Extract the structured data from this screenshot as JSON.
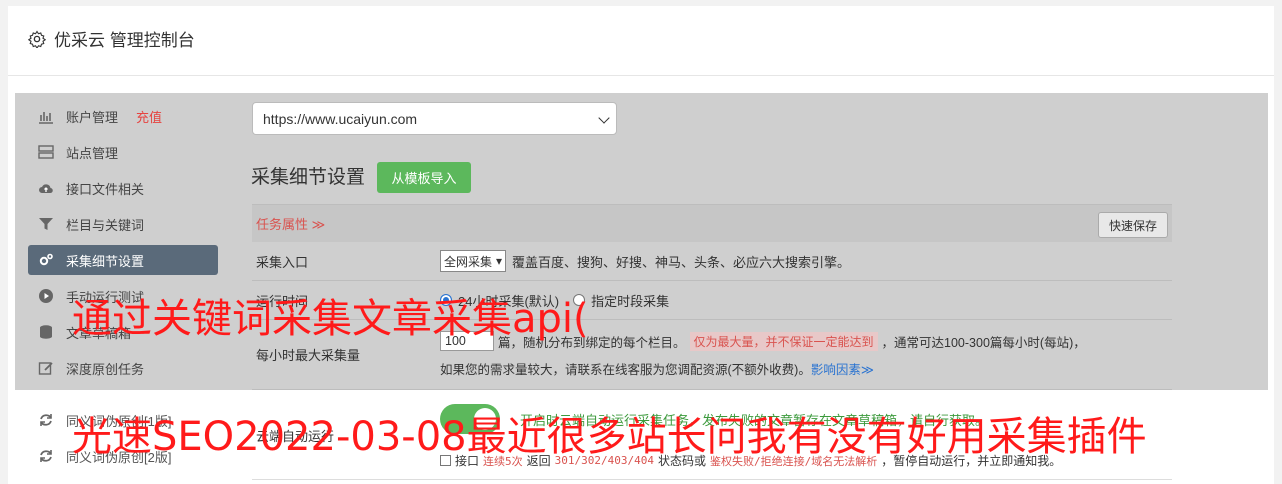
{
  "header": {
    "title": "优采云 管理控制台"
  },
  "sidebar": {
    "items": [
      {
        "label": "账户管理",
        "tag": "充值"
      },
      {
        "label": "站点管理"
      },
      {
        "label": "接口文件相关"
      },
      {
        "label": "栏目与关键词"
      },
      {
        "label": "采集细节设置",
        "active": true
      },
      {
        "label": "手动运行测试"
      },
      {
        "label": "文章草稿箱"
      },
      {
        "label": "深度原创任务"
      },
      {
        "label": "同义词伪原创[1版]"
      },
      {
        "label": "同义词伪原创[2版]"
      }
    ]
  },
  "site_select": {
    "value": "https://www.ucaiyun.com"
  },
  "section": {
    "title": "采集细节设置",
    "import_button": "从模板导入"
  },
  "table": {
    "header": {
      "label": "任务属性 ≫",
      "save_button": "快速保存"
    },
    "rows": {
      "entry": {
        "label": "采集入口",
        "select": "全网采集",
        "desc": "覆盖百度、搜狗、好搜、神马、头条、必应六大搜索引擎。"
      },
      "time": {
        "label": "运行时间",
        "opt1": "24小时采集(默认)",
        "opt2": "指定时段采集"
      },
      "rate": {
        "label": "每小时最大采集量",
        "value": "100",
        "desc1": "篇，随机分布到绑定的每个栏目。",
        "red": "仅为最大量，并不保证一定能达到",
        "desc2": "，通常可达100-300篇每小时(每站)，",
        "line2": "如果您的需求量较大，请联系在线客服为您调配资源(不额外收费)。",
        "link": "影响因素≫"
      }
    }
  },
  "bottom": {
    "label": "云端自动运行",
    "green": "开启时云端自动运行采集任务，发布失败的文章暂存在文章草稿箱，请自行获取。",
    "line2_a": "接口",
    "line2_code1": "连续5次",
    "line2_b": "返回",
    "line2_code2": "301/302/403/404",
    "line2_c": "状态码或",
    "line2_code3": "鉴权失败/拒绝连接/域名无法解析",
    "line2_d": "，暂停自动运行，并立即通知我。"
  },
  "overlay": {
    "line1": "通过关键词采集文章采集api(",
    "line2": "光速SEO2022-03-08最近很多站长问我有没有好用采集插件"
  }
}
